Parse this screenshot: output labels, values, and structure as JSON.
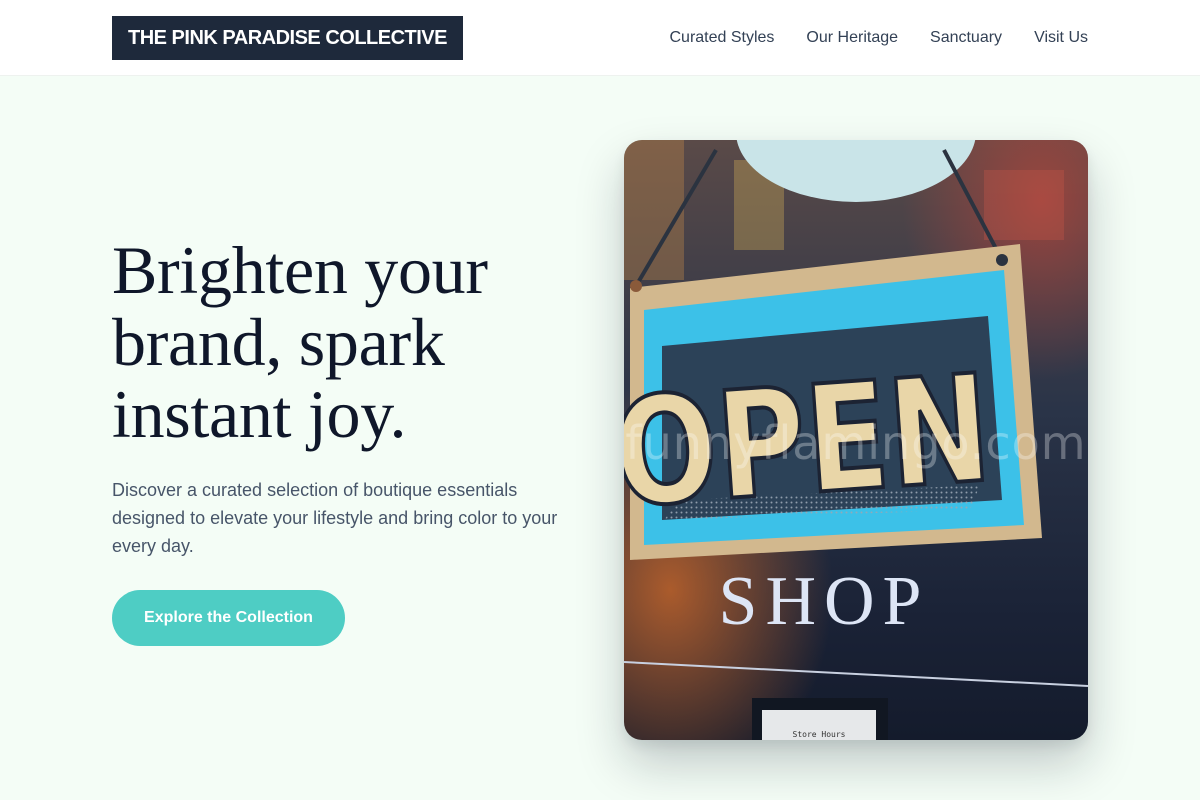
{
  "header": {
    "logo": "THE PINK PARADISE COLLECTIVE",
    "nav": [
      {
        "label": "Curated Styles"
      },
      {
        "label": "Our Heritage"
      },
      {
        "label": "Sanctuary"
      },
      {
        "label": "Visit Us"
      }
    ]
  },
  "hero": {
    "title": "Brighten your brand, spark instant joy.",
    "subtitle": "Discover a curated selection of boutique essentials designed to elevate your lifestyle and bring color to your every day.",
    "cta_label": "Explore the Collection"
  },
  "image": {
    "sign_text": "OPEN",
    "window_text": "SHOP",
    "small_card_text": "Store Hours",
    "watermark": "funnyflamingo.com"
  },
  "colors": {
    "accent": "#4ecdc4",
    "logo_bg": "#1e293b",
    "page_bg": "#f4fdf6",
    "heading": "#0f172a",
    "body_text": "#475569",
    "sign_blue": "#3cc1e8"
  }
}
